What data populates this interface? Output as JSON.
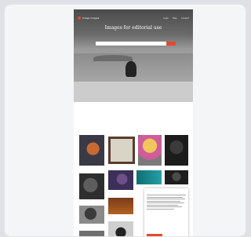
{
  "header": {
    "logo": "Imago Images",
    "nav": [
      "Login",
      "Help",
      "Contact"
    ]
  },
  "hero": {
    "title": "Images for editorial use",
    "subtitle": "",
    "search_placeholder": ""
  },
  "section": {
    "title_prefix": "",
    "title_accent": ""
  },
  "consent": {
    "title": "",
    "language": "",
    "subtitle": "",
    "accept_label": "",
    "settings_label": ""
  },
  "tiles": [
    {
      "caption": ""
    },
    {
      "caption": ""
    },
    {
      "caption": ""
    },
    {
      "caption": ""
    },
    {
      "caption": ""
    },
    {
      "caption": ""
    },
    {
      "caption": ""
    },
    {
      "caption": ""
    },
    {
      "caption": ""
    },
    {
      "caption": ""
    },
    {
      "caption": ""
    },
    {
      "caption": ""
    }
  ]
}
